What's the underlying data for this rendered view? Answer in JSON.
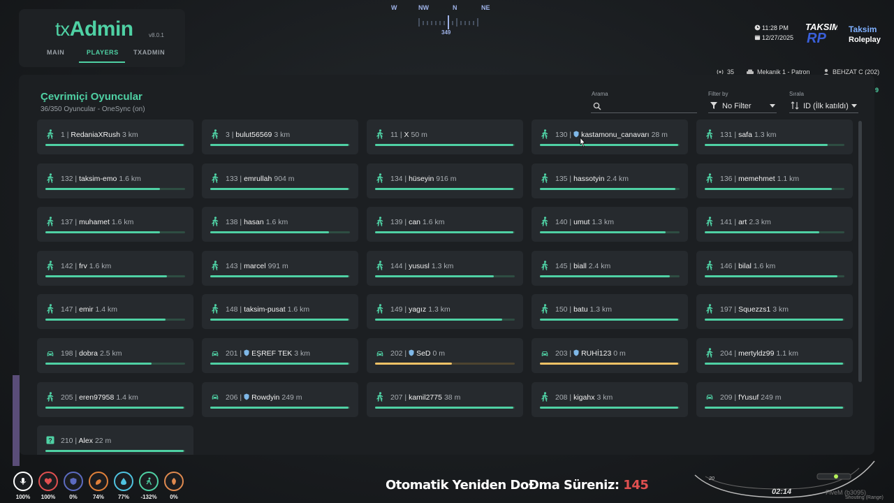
{
  "header": {
    "logo_prefix": "tx",
    "logo_main": "Admin",
    "version": "v8.0.1",
    "tabs": [
      {
        "label": "MAIN"
      },
      {
        "label": "PLAYERS"
      },
      {
        "label": "TXADMIN"
      }
    ],
    "active_tab": "PLAYERS"
  },
  "compass": {
    "letters": [
      "W",
      "NW",
      "N",
      "NE"
    ],
    "heading": "349"
  },
  "topright": {
    "time": "11:28 PM",
    "date": "12/27/2025",
    "server_name": "Taksim",
    "server_sub": "Roleplay",
    "logo_text": "TAKSIM RP",
    "online_count": "35",
    "job": "Mekanik 1 - Patron",
    "character": "BEHZAT C (202)",
    "side_number": "9"
  },
  "panel": {
    "title": "Çevrimiçi Oyuncular",
    "subtitle": "36/350 Oyuncular - OneSync (on)",
    "search_label": "Arama",
    "search_value": "",
    "filter_label": "Filter by",
    "filter_value": "No Filter",
    "sort_label": "Sırala",
    "sort_value": "ID (İlk katıldı)"
  },
  "players": [
    {
      "id": "1",
      "name": "RedaniaXRush",
      "dist": "3 km",
      "icon": "walk",
      "shield": false,
      "health": 0.99,
      "color": "green"
    },
    {
      "id": "3",
      "name": "bulut56569",
      "dist": "3 km",
      "icon": "walk",
      "shield": false,
      "health": 0.99,
      "color": "green"
    },
    {
      "id": "11",
      "name": "X",
      "dist": "50 m",
      "icon": "walk",
      "shield": false,
      "health": 0.99,
      "color": "green"
    },
    {
      "id": "130",
      "name": "kastamonu_canavarı",
      "dist": "28 m",
      "icon": "walk",
      "shield": true,
      "health": 0.99,
      "color": "green"
    },
    {
      "id": "131",
      "name": "safa",
      "dist": "1.3 km",
      "icon": "walk",
      "shield": false,
      "health": 0.88,
      "color": "green"
    },
    {
      "id": "132",
      "name": "taksim-emo",
      "dist": "1.6 km",
      "icon": "walk",
      "shield": false,
      "health": 0.82,
      "color": "green"
    },
    {
      "id": "133",
      "name": "emrullah",
      "dist": "904 m",
      "icon": "walk",
      "shield": false,
      "health": 0.99,
      "color": "green"
    },
    {
      "id": "134",
      "name": "hüseyin",
      "dist": "916 m",
      "icon": "walk",
      "shield": false,
      "health": 0.99,
      "color": "green"
    },
    {
      "id": "135",
      "name": "hassotyin",
      "dist": "2.4 km",
      "icon": "walk",
      "shield": false,
      "health": 0.97,
      "color": "green"
    },
    {
      "id": "136",
      "name": "memehmet",
      "dist": "1.1 km",
      "icon": "walk",
      "shield": false,
      "health": 0.91,
      "color": "green"
    },
    {
      "id": "137",
      "name": "muhamet",
      "dist": "1.6 km",
      "icon": "walk",
      "shield": false,
      "health": 0.82,
      "color": "green"
    },
    {
      "id": "138",
      "name": "hasan",
      "dist": "1.6 km",
      "icon": "walk",
      "shield": false,
      "health": 0.85,
      "color": "green"
    },
    {
      "id": "139",
      "name": "can",
      "dist": "1.6 km",
      "icon": "walk",
      "shield": false,
      "health": 0.99,
      "color": "green"
    },
    {
      "id": "140",
      "name": "umut",
      "dist": "1.3 km",
      "icon": "walk",
      "shield": false,
      "health": 0.9,
      "color": "green"
    },
    {
      "id": "141",
      "name": "art",
      "dist": "2.3 km",
      "icon": "walk",
      "shield": false,
      "health": 0.82,
      "color": "green"
    },
    {
      "id": "142",
      "name": "frv",
      "dist": "1.6 km",
      "icon": "walk",
      "shield": false,
      "health": 0.87,
      "color": "green"
    },
    {
      "id": "143",
      "name": "marcel",
      "dist": "991 m",
      "icon": "walk",
      "shield": false,
      "health": 0.99,
      "color": "green"
    },
    {
      "id": "144",
      "name": "yususl",
      "dist": "1.3 km",
      "icon": "walk",
      "shield": false,
      "health": 0.85,
      "color": "green"
    },
    {
      "id": "145",
      "name": "biall",
      "dist": "2.4 km",
      "icon": "walk",
      "shield": false,
      "health": 0.93,
      "color": "green"
    },
    {
      "id": "146",
      "name": "bilal",
      "dist": "1.6 km",
      "icon": "walk",
      "shield": false,
      "health": 0.95,
      "color": "green"
    },
    {
      "id": "147",
      "name": "emir",
      "dist": "1.4 km",
      "icon": "walk",
      "shield": false,
      "health": 0.86,
      "color": "green"
    },
    {
      "id": "148",
      "name": "taksim-pusat",
      "dist": "1.6 km",
      "icon": "walk",
      "shield": false,
      "health": 0.99,
      "color": "green"
    },
    {
      "id": "149",
      "name": "yagız",
      "dist": "1.3 km",
      "icon": "walk",
      "shield": false,
      "health": 0.91,
      "color": "green"
    },
    {
      "id": "150",
      "name": "batu",
      "dist": "1.3 km",
      "icon": "walk",
      "shield": false,
      "health": 0.99,
      "color": "green"
    },
    {
      "id": "197",
      "name": "Squezzs1",
      "dist": "3 km",
      "icon": "walk",
      "shield": false,
      "health": 0.99,
      "color": "green"
    },
    {
      "id": "198",
      "name": "dobra",
      "dist": "2.5 km",
      "icon": "car",
      "shield": false,
      "health": 0.76,
      "color": "green"
    },
    {
      "id": "201",
      "name": "EŞREF TEK",
      "dist": "3 km",
      "icon": "car",
      "shield": true,
      "health": 0.99,
      "color": "green"
    },
    {
      "id": "202",
      "name": "SeD",
      "dist": "0 m",
      "icon": "car",
      "shield": true,
      "health": 0.55,
      "color": "yellow"
    },
    {
      "id": "203",
      "name": "RUHİ123",
      "dist": "0 m",
      "icon": "car",
      "shield": true,
      "health": 0.99,
      "color": "yellow"
    },
    {
      "id": "204",
      "name": "mertyldz99",
      "dist": "1.1 km",
      "icon": "walk",
      "shield": false,
      "health": 0.99,
      "color": "green"
    },
    {
      "id": "205",
      "name": "eren97958",
      "dist": "1.4 km",
      "icon": "walk",
      "shield": false,
      "health": 0.99,
      "color": "green"
    },
    {
      "id": "206",
      "name": "Rowdyin",
      "dist": "249 m",
      "icon": "car",
      "shield": true,
      "health": 0.99,
      "color": "green"
    },
    {
      "id": "207",
      "name": "kamil2775",
      "dist": "38 m",
      "icon": "walk",
      "shield": false,
      "health": 0.99,
      "color": "green"
    },
    {
      "id": "208",
      "name": "kigahx",
      "dist": "3 km",
      "icon": "walk",
      "shield": false,
      "health": 0.99,
      "color": "green"
    },
    {
      "id": "209",
      "name": "fYusuf",
      "dist": "249 m",
      "icon": "car",
      "shield": false,
      "health": 0.99,
      "color": "green"
    },
    {
      "id": "210",
      "name": "Alex",
      "dist": "22 m",
      "icon": "unknown",
      "shield": false,
      "health": 0.99,
      "color": "green"
    }
  ],
  "hud": {
    "items": [
      {
        "name": "mic-icon",
        "value": "100%",
        "ring": "#ffffff"
      },
      {
        "name": "health-icon",
        "value": "100%",
        "ring": "#e05050"
      },
      {
        "name": "armor-icon",
        "value": "0%",
        "ring": "#5c6bc0"
      },
      {
        "name": "food-icon",
        "value": "74%",
        "ring": "#e0803a"
      },
      {
        "name": "water-icon",
        "value": "77%",
        "ring": "#4fc3e0"
      },
      {
        "name": "stamina-icon",
        "value": "-132%",
        "ring": "#4fd1a4"
      },
      {
        "name": "stress-icon",
        "value": "0%",
        "ring": "#e08a4f"
      }
    ],
    "respawn_text": "Otomatik Yeniden DoÐma Süreniz:",
    "respawn_value": "145",
    "speedo_time": "02:14",
    "speedo_gear": "20",
    "watermark": "FiveM (b3095)",
    "watermark2": "Shouting (Range)"
  },
  "colors": {
    "accent": "#4fd1a4",
    "warn_bar": "#f0c266",
    "panel_bg": "#1c1f22",
    "card_bg": "#262a2e"
  }
}
